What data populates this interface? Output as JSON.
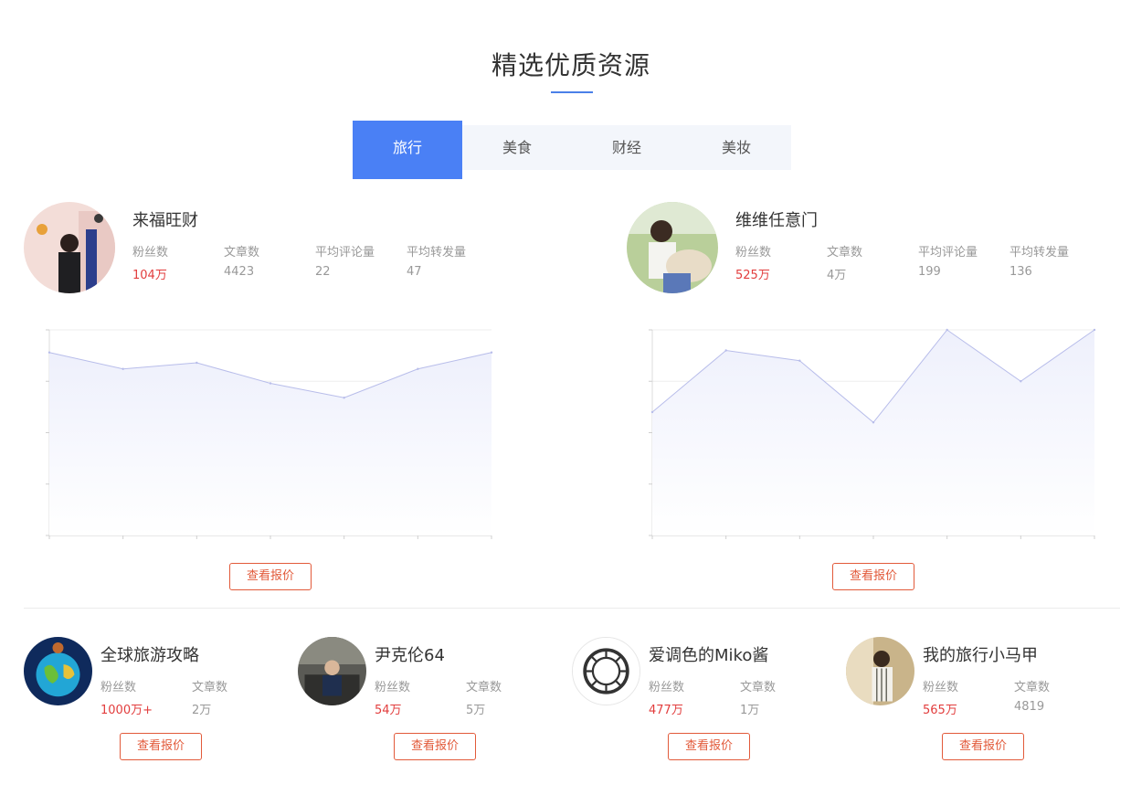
{
  "section": {
    "title": "精选优质资源"
  },
  "tabs": [
    {
      "label": "旅行",
      "active": true
    },
    {
      "label": "美食",
      "active": false
    },
    {
      "label": "财经",
      "active": false
    },
    {
      "label": "美妆",
      "active": false
    }
  ],
  "featured": [
    {
      "name": "来福旺财",
      "stats": [
        {
          "label": "粉丝数",
          "value": "104万"
        },
        {
          "label": "文章数",
          "value": "4423"
        },
        {
          "label": "平均评论量",
          "value": "22"
        },
        {
          "label": "平均转发量",
          "value": "47"
        }
      ],
      "button": "查看报价"
    },
    {
      "name": "维维任意门",
      "stats": [
        {
          "label": "粉丝数",
          "value": "525万"
        },
        {
          "label": "文章数",
          "value": "4万"
        },
        {
          "label": "平均评论量",
          "value": "199"
        },
        {
          "label": "平均转发量",
          "value": "136"
        }
      ],
      "button": "查看报价"
    }
  ],
  "chart_data": [
    {
      "type": "area",
      "x": [
        0,
        1,
        2,
        3,
        4,
        5,
        6
      ],
      "values": [
        0.89,
        0.81,
        0.84,
        0.74,
        0.67,
        0.81,
        0.89
      ],
      "ylim": [
        0,
        1
      ],
      "grid": true,
      "color": "#b8bdea",
      "fill": "#eef0fc"
    },
    {
      "type": "area",
      "x": [
        0,
        1,
        2,
        3,
        4,
        5,
        6
      ],
      "values": [
        0.6,
        0.9,
        0.85,
        0.55,
        1.0,
        0.75,
        1.0
      ],
      "ylim": [
        0,
        1
      ],
      "grid": true,
      "color": "#b8bdea",
      "fill": "#eef0fc"
    }
  ],
  "others": [
    {
      "name": "全球旅游攻略",
      "stats": [
        {
          "label": "粉丝数",
          "value": "1000万+"
        },
        {
          "label": "文章数",
          "value": "2万"
        }
      ],
      "button": "查看报价"
    },
    {
      "name": "尹克伦64",
      "stats": [
        {
          "label": "粉丝数",
          "value": "54万"
        },
        {
          "label": "文章数",
          "value": "5万"
        }
      ],
      "button": "查看报价"
    },
    {
      "name": "爱调色的Miko酱",
      "stats": [
        {
          "label": "粉丝数",
          "value": "477万"
        },
        {
          "label": "文章数",
          "value": "1万"
        }
      ],
      "button": "查看报价"
    },
    {
      "name": "我的旅行小马甲",
      "stats": [
        {
          "label": "粉丝数",
          "value": "565万"
        },
        {
          "label": "文章数",
          "value": "4819"
        }
      ],
      "button": "查看报价"
    }
  ],
  "colors": {
    "accent": "#4a80f5",
    "fans": "#e23d3d",
    "button": "#e25a3a"
  }
}
